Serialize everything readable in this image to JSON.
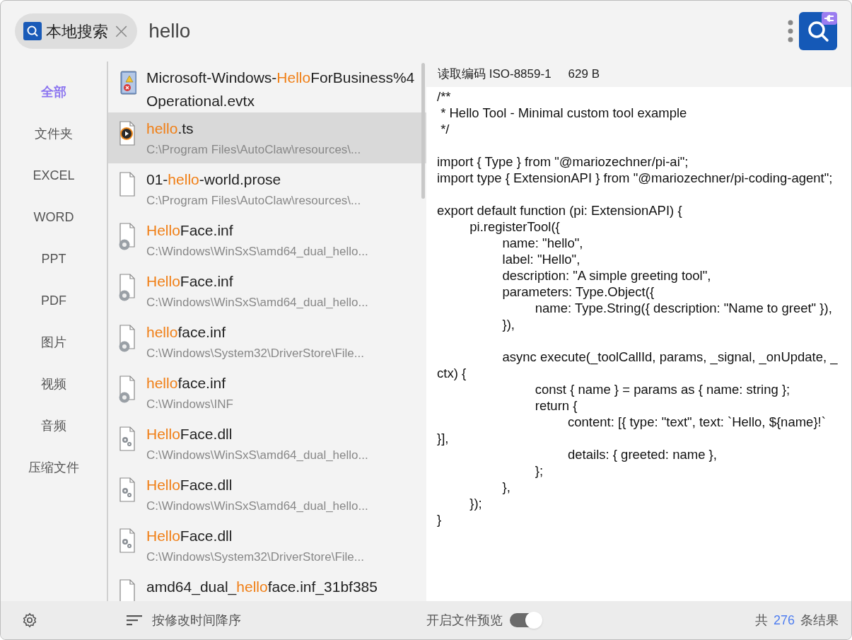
{
  "search": {
    "scope_chip": "本地搜索",
    "close_glyph": "×",
    "query": "hello"
  },
  "categories": [
    {
      "label": "全部",
      "selected": true
    },
    {
      "label": "文件夹",
      "selected": false
    },
    {
      "label": "EXCEL",
      "selected": false
    },
    {
      "label": "WORD",
      "selected": false
    },
    {
      "label": "PPT",
      "selected": false
    },
    {
      "label": "PDF",
      "selected": false
    },
    {
      "label": "图片",
      "selected": false
    },
    {
      "label": "视频",
      "selected": false
    },
    {
      "label": "音频",
      "selected": false
    },
    {
      "label": "压缩文件",
      "selected": false
    }
  ],
  "results": [
    {
      "kind": "log",
      "selected": false,
      "name": [
        {
          "text": "Microsoft-Windows-",
          "match": false
        },
        {
          "text": "Hello",
          "match": true
        },
        {
          "text": "ForBusiness%4Operational.evtx",
          "match": false
        }
      ]
    },
    {
      "kind": "media",
      "selected": true,
      "name": [
        {
          "text": "hello",
          "match": true
        },
        {
          "text": ".ts",
          "match": false
        }
      ],
      "path": "C:\\Program Files\\AutoClaw\\resources\\..."
    },
    {
      "kind": "blank",
      "selected": false,
      "name": [
        {
          "text": "01-",
          "match": false
        },
        {
          "text": "hello",
          "match": true
        },
        {
          "text": "-world.prose",
          "match": false
        }
      ],
      "path": "C:\\Program Files\\AutoClaw\\resources\\..."
    },
    {
      "kind": "setup",
      "selected": false,
      "name": [
        {
          "text": "Hello",
          "match": true
        },
        {
          "text": "Face.inf",
          "match": false
        }
      ],
      "path": "C:\\Windows\\WinSxS\\amd64_dual_hello..."
    },
    {
      "kind": "setup",
      "selected": false,
      "name": [
        {
          "text": "Hello",
          "match": true
        },
        {
          "text": "Face.inf",
          "match": false
        }
      ],
      "path": "C:\\Windows\\WinSxS\\amd64_dual_hello..."
    },
    {
      "kind": "setup",
      "selected": false,
      "name": [
        {
          "text": "hello",
          "match": true
        },
        {
          "text": "face.inf",
          "match": false
        }
      ],
      "path": "C:\\Windows\\System32\\DriverStore\\File..."
    },
    {
      "kind": "setup",
      "selected": false,
      "name": [
        {
          "text": "hello",
          "match": true
        },
        {
          "text": "face.inf",
          "match": false
        }
      ],
      "path": "C:\\Windows\\INF"
    },
    {
      "kind": "library",
      "selected": false,
      "name": [
        {
          "text": "Hello",
          "match": true
        },
        {
          "text": "Face.dll",
          "match": false
        }
      ],
      "path": "C:\\Windows\\WinSxS\\amd64_dual_hello..."
    },
    {
      "kind": "library",
      "selected": false,
      "name": [
        {
          "text": "Hello",
          "match": true
        },
        {
          "text": "Face.dll",
          "match": false
        }
      ],
      "path": "C:\\Windows\\WinSxS\\amd64_dual_hello..."
    },
    {
      "kind": "library",
      "selected": false,
      "name": [
        {
          "text": "Hello",
          "match": true
        },
        {
          "text": "Face.dll",
          "match": false
        }
      ],
      "path": "C:\\Windows\\System32\\DriverStore\\File..."
    },
    {
      "kind": "blank",
      "selected": false,
      "name": [
        {
          "text": "amd64_dual_",
          "match": false
        },
        {
          "text": "hello",
          "match": true
        },
        {
          "text": "face.inf_31bf385",
          "match": false
        }
      ]
    }
  ],
  "preview": {
    "encoding_label": "读取编码 ISO-8859-1",
    "size": "629 B",
    "code": "/**\n * Hello Tool - Minimal custom tool example\n */\n\nimport { Type } from \"@mariozechner/pi-ai\";\nimport type { ExtensionAPI } from \"@mariozechner/pi-coding-agent\";\n\nexport default function (pi: ExtensionAPI) {\n\tpi.registerTool({\n\t\tname: \"hello\",\n\t\tlabel: \"Hello\",\n\t\tdescription: \"A simple greeting tool\",\n\t\tparameters: Type.Object({\n\t\t\tname: Type.String({ description: \"Name to greet\" }),\n\t\t}),\n\n\t\tasync execute(_toolCallId, params, _signal, _onUpdate, _ctx) {\n\t\t\tconst { name } = params as { name: string };\n\t\t\treturn {\n\t\t\t\tcontent: [{ type: \"text\", text: `Hello, ${name}!` }],\n\t\t\t\tdetails: { greeted: name },\n\t\t\t};\n\t\t},\n\t});\n}"
  },
  "status_bar": {
    "sort": "按修改时间降序",
    "preview_toggle": {
      "label": "开启文件预览",
      "on": true
    },
    "count_prefix": "共",
    "count": "276",
    "count_suffix": "条结果"
  }
}
